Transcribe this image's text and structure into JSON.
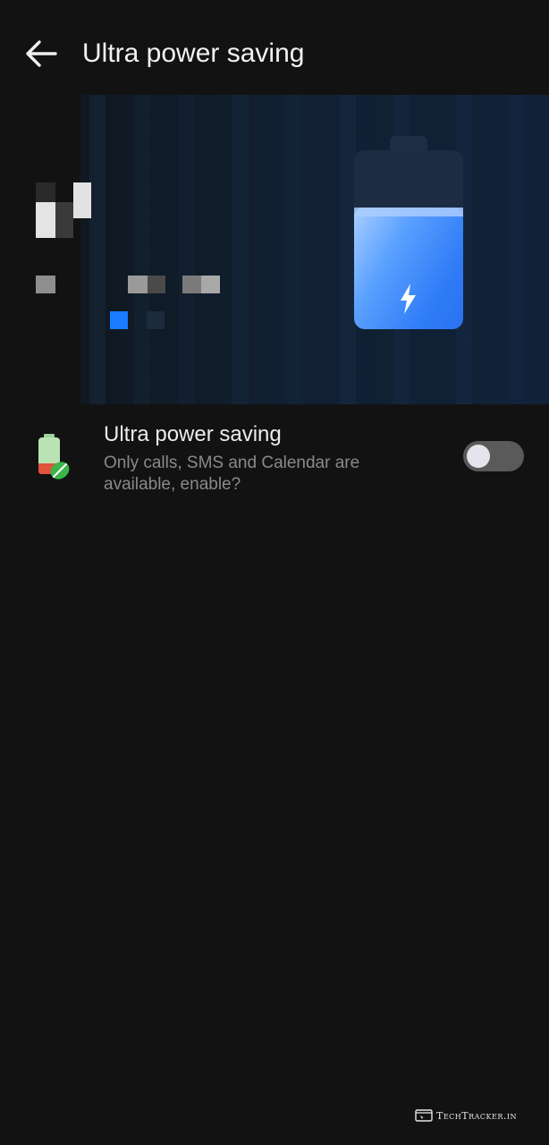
{
  "header": {
    "title": "Ultra power saving",
    "back_icon": "arrow-left-icon"
  },
  "banner": {
    "illustration": "battery-charging-icon",
    "accent_color": "#2f7cf6"
  },
  "setting": {
    "icon": "battery-leaf-icon",
    "title": "Ultra power saving",
    "description": "Only calls, SMS and Calendar are available, enable?",
    "toggle_on": false
  },
  "watermark": {
    "text": "TechTracker.in"
  },
  "colors": {
    "background": "#121212",
    "title_text": "#f2f2f2",
    "secondary_text": "#8a8a8a",
    "toggle_off": "#5a5a5a"
  }
}
